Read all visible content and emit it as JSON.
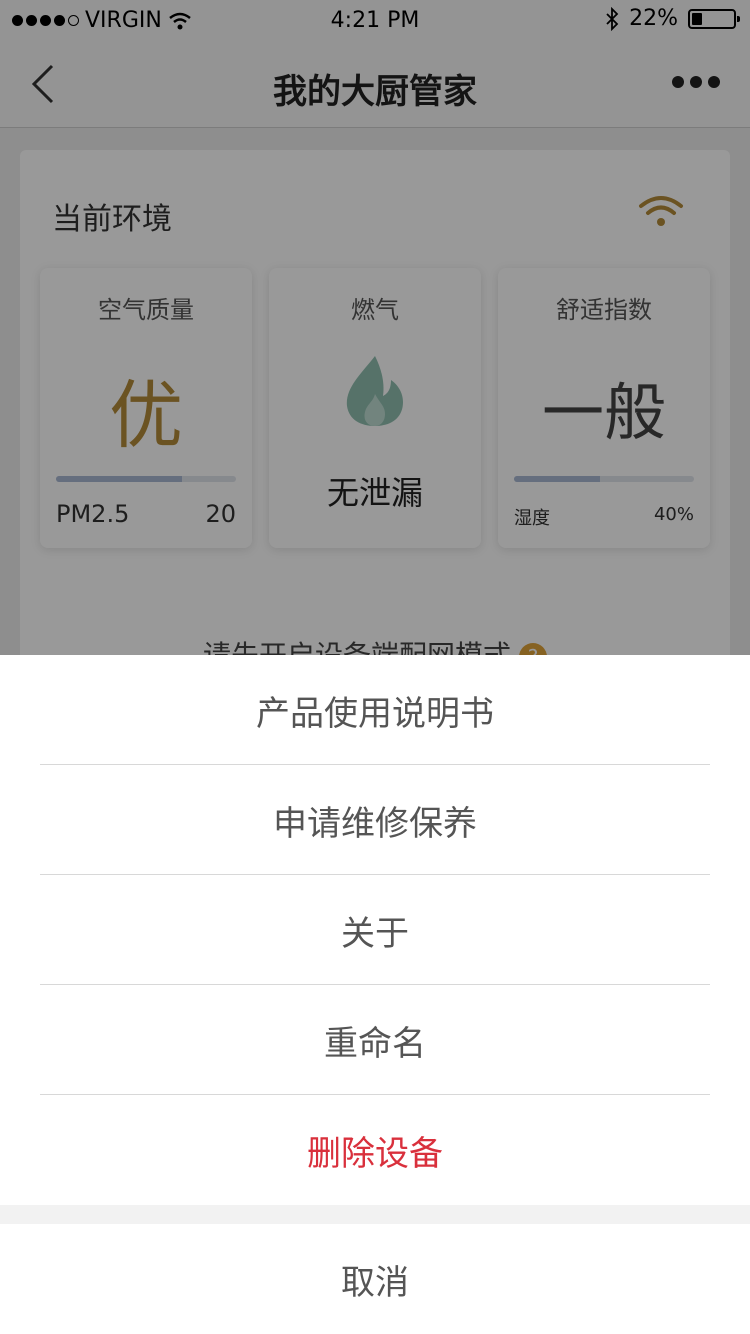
{
  "status_bar": {
    "carrier": "VIRGIN",
    "time": "4:21 PM",
    "battery": "22%",
    "battery_level": 0.22
  },
  "nav": {
    "title": "我的大厨管家",
    "back_icon": "chevron-left-icon",
    "more_icon": "more-icon"
  },
  "environment": {
    "title": "当前环境",
    "connection_icon": "wifi-icon",
    "air_quality": {
      "label": "空气质量",
      "value": "优",
      "pm_label": "PM2.5",
      "pm_value": "20",
      "level": 0.7
    },
    "gas": {
      "label": "燃气",
      "status": "无泄漏",
      "icon": "flame-icon"
    },
    "comfort": {
      "label": "舒适指数",
      "value": "一般",
      "humidity_label": "湿度",
      "humidity_value": "40%",
      "level": 0.48
    },
    "hint": "请先开启设备端配网模式",
    "hint_icon": "question-icon"
  },
  "action_sheet": {
    "options": [
      {
        "label": "产品使用说明书"
      },
      {
        "label": "申请维修保养"
      },
      {
        "label": "关于"
      },
      {
        "label": "重命名"
      },
      {
        "label": "删除设备"
      }
    ],
    "cancel_label": "取消"
  },
  "colors": {
    "accent_gold": "#b38a3a",
    "danger": "#d9303c",
    "overlay": "rgba(0,0,0,0.4)"
  }
}
